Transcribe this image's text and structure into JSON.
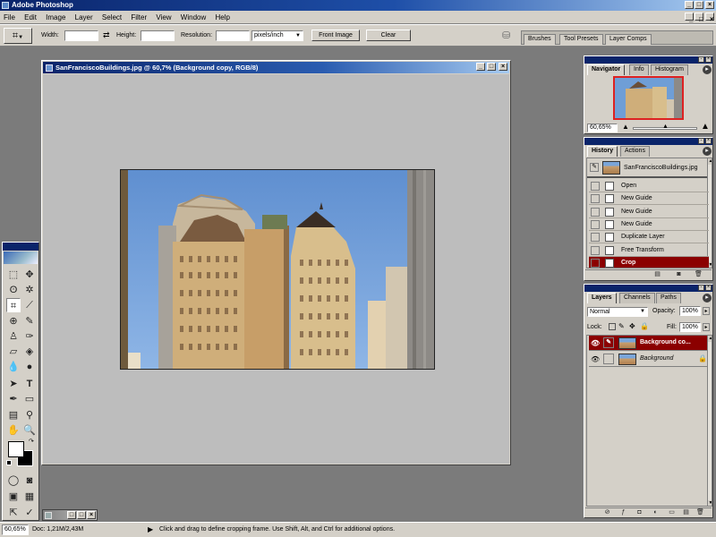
{
  "app": {
    "title": "Adobe Photoshop"
  },
  "menu": [
    "File",
    "Edit",
    "Image",
    "Layer",
    "Select",
    "Filter",
    "View",
    "Window",
    "Help"
  ],
  "options": {
    "width_label": "Width:",
    "height_label": "Height:",
    "resolution_label": "Resolution:",
    "units_value": "pixels/inch",
    "front_image_label": "Front Image",
    "clear_label": "Clear"
  },
  "palette_well": {
    "tabs": [
      "Brushes",
      "Tool Presets",
      "Layer Comps"
    ]
  },
  "document": {
    "title": "SanFranciscoBuildings.jpg @ 60,7% (Background copy, RGB/8)"
  },
  "navigator": {
    "tabs": [
      "Navigator",
      "Info",
      "Histogram"
    ],
    "zoom_value": "60,65%",
    "zoom_level": 0.5
  },
  "history": {
    "tabs": [
      "History",
      "Actions"
    ],
    "snapshot_name": "SanFranciscoBuildings.jpg",
    "steps": [
      "Open",
      "New Guide",
      "New Guide",
      "New Guide",
      "Duplicate Layer",
      "Free Transform",
      "Crop"
    ],
    "selected_step": "Crop"
  },
  "layers": {
    "tabs": [
      "Layers",
      "Channels",
      "Paths"
    ],
    "blend_mode": "Normal",
    "opacity_label": "Opacity:",
    "opacity_value": "100%",
    "lock_label": "Lock:",
    "fill_label": "Fill:",
    "fill_value": "100%",
    "items": [
      {
        "name": "Background co...",
        "selected": true
      },
      {
        "name": "Background",
        "selected": false
      }
    ]
  },
  "status": {
    "zoom_value": "60,65%",
    "doc_info": "Doc: 1,21M/2,43M",
    "hint": "Click and drag to define cropping frame. Use Shift, Alt, and Ctrl for additional options."
  },
  "colors": {
    "selection": "#8b0000",
    "titlebar": "#0a246a",
    "chrome": "#d4d0c8",
    "workspace": "#7b7b7b"
  }
}
